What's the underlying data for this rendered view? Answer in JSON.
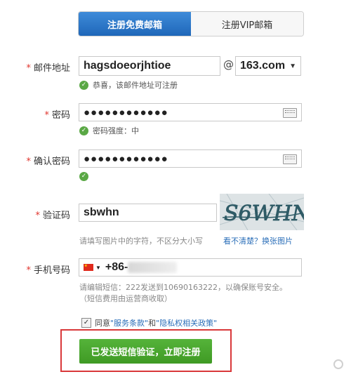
{
  "tabs": [
    {
      "label": "注册免费邮箱",
      "active": true
    },
    {
      "label": "注册VIP邮箱",
      "active": false
    }
  ],
  "email": {
    "label": "邮件地址",
    "value": "hagsdoeorjhtioe",
    "at": "@",
    "domain": "163.com",
    "hint": "恭喜，该邮件地址可注册"
  },
  "password": {
    "label": "密码",
    "value": "●●●●●●●●●●●●",
    "hint": "密码强度：中"
  },
  "confirm": {
    "label": "确认密码",
    "value": "●●●●●●●●●●●●"
  },
  "captcha": {
    "label": "验证码",
    "value": "sbwhn",
    "hint": "请填写图片中的字符，不区分大小写",
    "image_text": "S6WHN",
    "refresh": "看不清楚？换张图片"
  },
  "phone": {
    "label": "手机号码",
    "prefix": "+86-",
    "hint1": "请编辑短信：222发送到10690163222，以确保账号安全。",
    "hint2": "（短信费用由运营商收取）"
  },
  "agree": {
    "prefix": "同意",
    "terms": "\"服务条款\"",
    "and": "和",
    "privacy": "\"隐私权相关政策\"",
    "checked": true
  },
  "submit_label": "已发送短信验证，立即注册",
  "colors": {
    "required_star": "#e0342c",
    "tab_active": "#2a74c6",
    "submit": "#4aa630",
    "highlight_box": "#d9383a",
    "link": "#2a6eb8"
  },
  "icons": {
    "check": "green-check-icon",
    "keyboard": "keyboard-icon",
    "flag": "china-flag-icon"
  }
}
